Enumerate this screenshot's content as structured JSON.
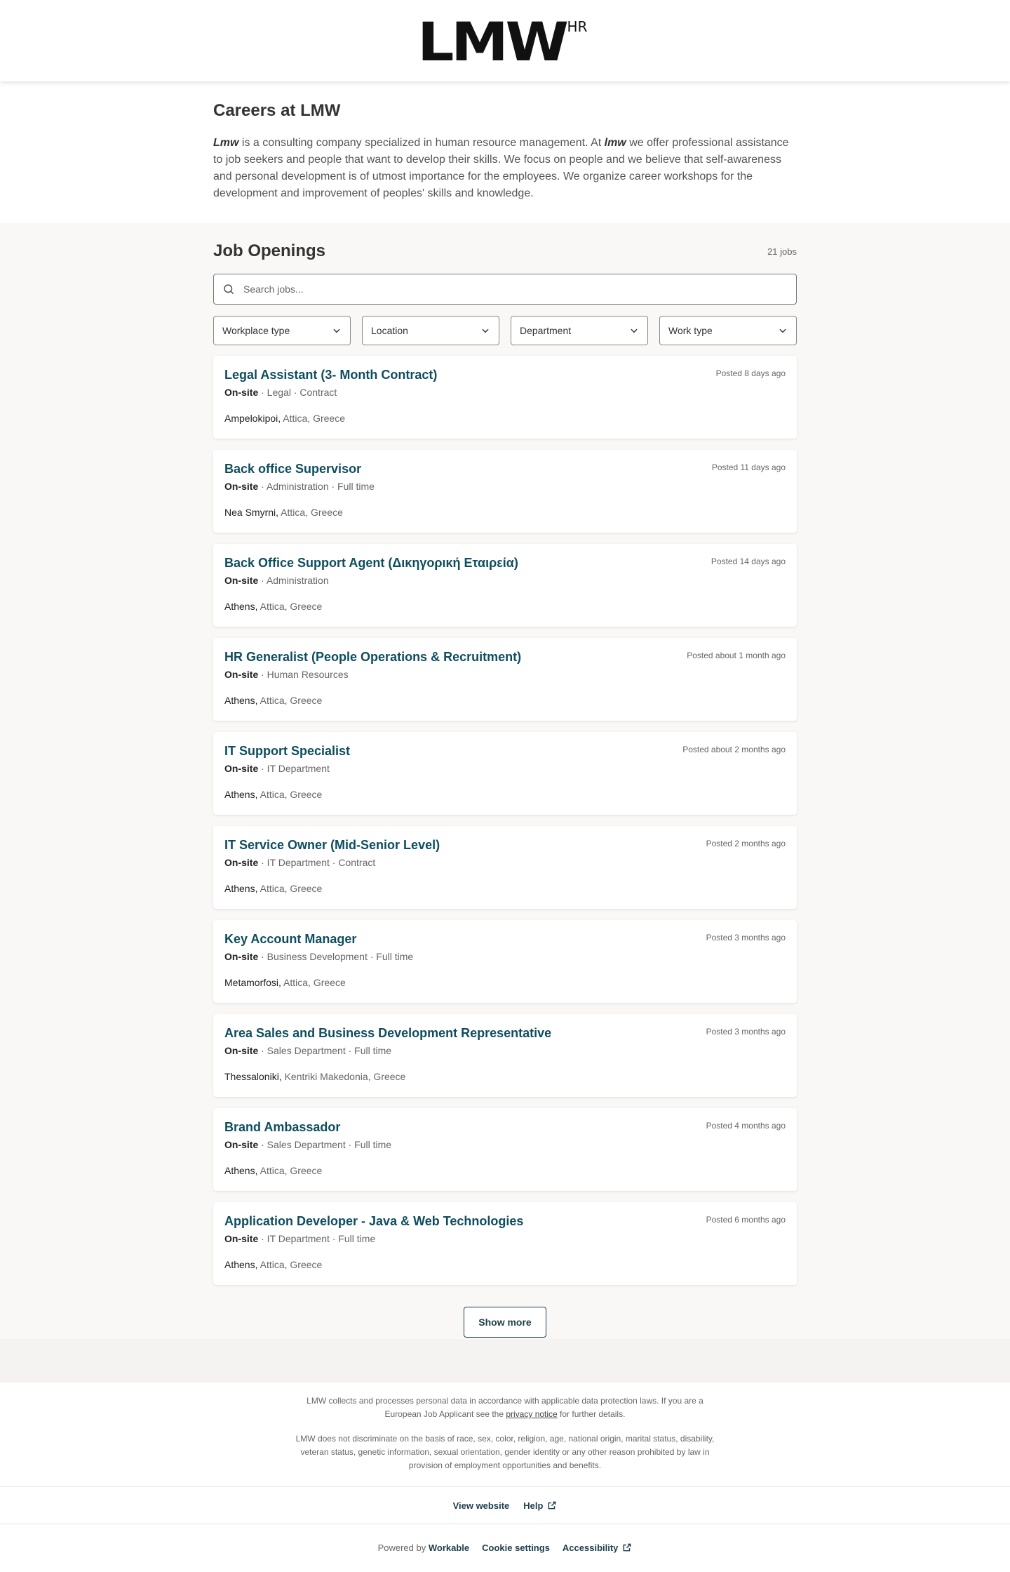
{
  "brand": {
    "logo_text": "LMW",
    "logo_sup": "HR"
  },
  "intro": {
    "title": "Careers at LMW",
    "company_a": "Lmw",
    "text_a": " is a consulting company specialized in human resource management. At ",
    "company_b": "lmw",
    "text_b": " we offer professional assistance to job seekers and people that want to develop their skills. We focus on people and we believe that self-awareness and personal development is of utmost importance for the employees. We organize career workshops for the development and improvement of peoples' skills and knowledge."
  },
  "jobs_section": {
    "title": "Job Openings",
    "count": "21 jobs",
    "search_placeholder": "Search jobs...",
    "filters": [
      "Workplace type",
      "Location",
      "Department",
      "Work type"
    ],
    "show_more": "Show more"
  },
  "jobs": [
    {
      "title": "Legal Assistant (3- Month Contract)",
      "posted": "Posted 8 days ago",
      "workplace": "On-site",
      "meta": " · Legal · Contract",
      "city": "Ampelokipoi,",
      "region": " Attica, Greece"
    },
    {
      "title": "Back office Supervisor",
      "posted": "Posted 11 days ago",
      "workplace": "On-site",
      "meta": " · Administration · Full time",
      "city": "Nea Smyrni,",
      "region": " Attica, Greece"
    },
    {
      "title": "Back Office Support Agent (Δικηγορική Εταιρεία)",
      "posted": "Posted 14 days ago",
      "workplace": "On-site",
      "meta": " · Administration",
      "city": "Athens,",
      "region": " Attica, Greece"
    },
    {
      "title": "HR Generalist (People Operations & Recruitment)",
      "posted": "Posted about 1 month ago",
      "workplace": "On-site",
      "meta": " · Human Resources",
      "city": "Athens,",
      "region": " Attica, Greece"
    },
    {
      "title": "IT Support Specialist",
      "posted": "Posted about 2 months ago",
      "workplace": "On-site",
      "meta": " · IT Department",
      "city": "Athens,",
      "region": " Attica, Greece"
    },
    {
      "title": "IT Service Owner (Mid-Senior Level)",
      "posted": "Posted 2 months ago",
      "workplace": "On-site",
      "meta": " · IT Department · Contract",
      "city": "Athens,",
      "region": " Attica, Greece"
    },
    {
      "title": "Key Account Manager",
      "posted": "Posted 3 months ago",
      "workplace": "On-site",
      "meta": " · Business Development · Full time",
      "city": "Metamorfosi,",
      "region": " Attica, Greece"
    },
    {
      "title": "Area Sales and Business Development Representative",
      "posted": "Posted 3 months ago",
      "workplace": "On-site",
      "meta": " · Sales Department · Full time",
      "city": "Thessaloniki,",
      "region": " Kentriki Makedonia, Greece"
    },
    {
      "title": "Brand Ambassador",
      "posted": "Posted 4 months ago",
      "workplace": "On-site",
      "meta": " · Sales Department · Full time",
      "city": "Athens,",
      "region": " Attica, Greece"
    },
    {
      "title": "Application Developer - Java & Web Technologies",
      "posted": "Posted 6 months ago",
      "workplace": "On-site",
      "meta": " · IT Department · Full time",
      "city": "Athens,",
      "region": " Attica, Greece"
    }
  ],
  "footer": {
    "notice_a": "LMW collects and processes personal data in accordance with applicable data protection laws. If you are a European Job Applicant see the ",
    "privacy_link": "privacy notice",
    "notice_b": " for further details.",
    "notice_2": "LMW does not discriminate on the basis of race, sex, color, religion, age, national origin, marital status, disability, veteran status, genetic information, sexual orientation, gender identity or any other reason prohibited by law in provision of employment opportunities and benefits.",
    "view_website": "View website",
    "help": "Help",
    "powered_by": "Powered by ",
    "workable": "Workable",
    "cookie_settings": "Cookie settings",
    "accessibility": "Accessibility"
  }
}
